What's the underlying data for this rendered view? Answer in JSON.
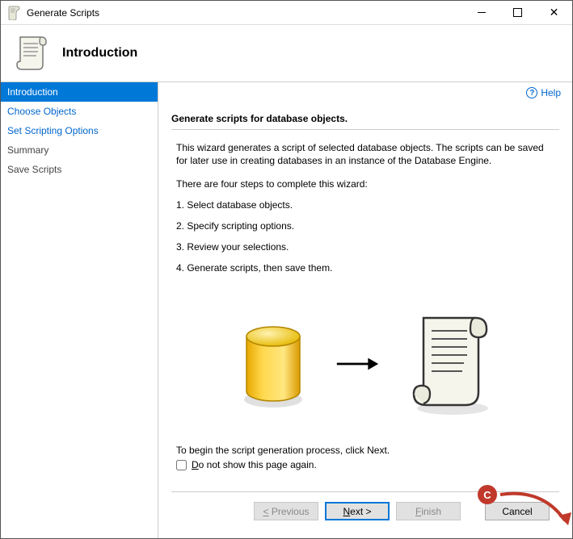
{
  "window": {
    "title": "Generate Scripts"
  },
  "header": {
    "title": "Introduction"
  },
  "help": {
    "label": "Help"
  },
  "sidebar": {
    "items": [
      {
        "label": "Introduction",
        "active": true,
        "plain": false
      },
      {
        "label": "Choose Objects",
        "active": false,
        "plain": false
      },
      {
        "label": "Set Scripting Options",
        "active": false,
        "plain": false
      },
      {
        "label": "Summary",
        "active": false,
        "plain": true
      },
      {
        "label": "Save Scripts",
        "active": false,
        "plain": true
      }
    ]
  },
  "content": {
    "heading": "Generate scripts for database objects.",
    "intro": "This wizard generates a script of selected database objects. The scripts can be saved for later use in creating databases in an instance of the Database Engine.",
    "steps_intro": "There are four steps to complete this wizard:",
    "steps": [
      "1. Select database objects.",
      "2. Specify scripting options.",
      "3. Review your selections.",
      "4. Generate scripts, then save them."
    ],
    "footer": "To begin the script generation process, click Next.",
    "checkbox_label": "Do not show this page again."
  },
  "buttons": {
    "previous": "< Previous",
    "next": "Next >",
    "finish": "Finish",
    "cancel": "Cancel"
  },
  "annotation": {
    "label": "C"
  }
}
